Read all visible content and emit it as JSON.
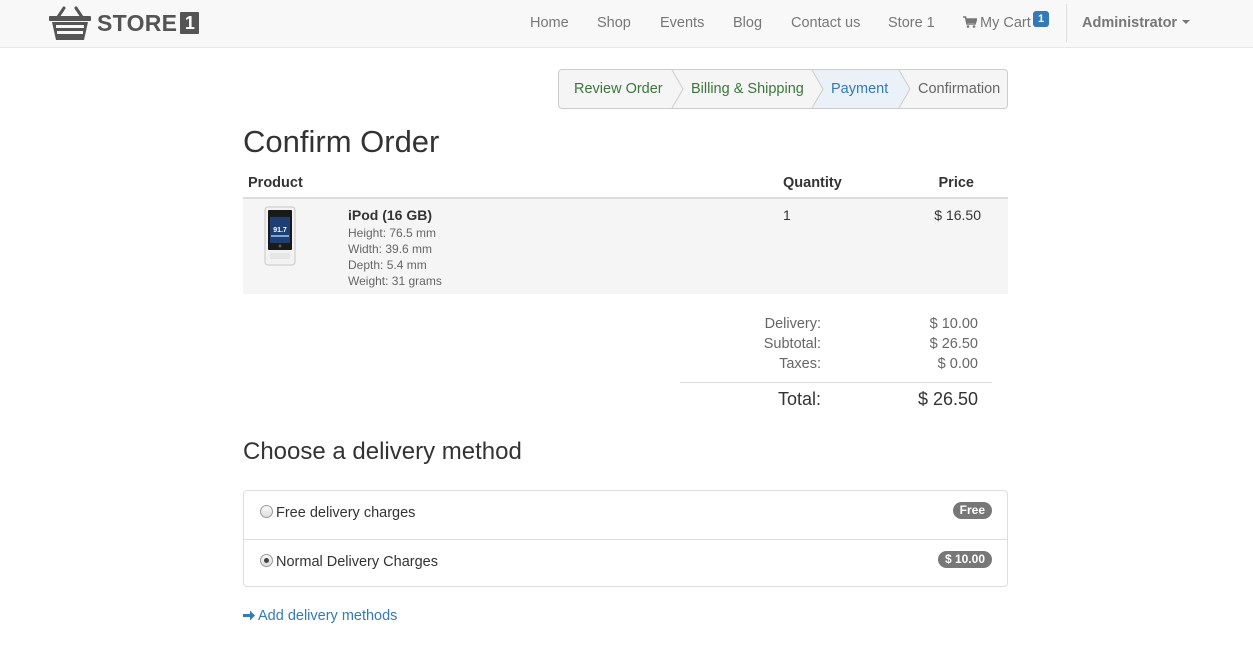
{
  "brand": {
    "name": "STORE",
    "number": "1"
  },
  "nav": {
    "items": [
      "Home",
      "Shop",
      "Events",
      "Blog",
      "Contact us",
      "Store 1"
    ],
    "cart_label": "My Cart",
    "cart_count": "1",
    "user": "Administrator"
  },
  "wizard": {
    "steps": [
      "Review Order",
      "Billing & Shipping",
      "Payment",
      "Confirmation"
    ],
    "active": "Payment"
  },
  "page_title": "Confirm Order",
  "table": {
    "headers": {
      "product": "Product",
      "quantity": "Quantity",
      "price": "Price"
    },
    "rows": [
      {
        "name": "iPod (16 GB)",
        "attrs": [
          "Height: 76.5 mm",
          "Width: 39.6 mm",
          "Depth: 5.4 mm",
          "Weight: 31 grams"
        ],
        "image_screen_text": "91.7",
        "quantity": "1",
        "price": "$ 16.50"
      }
    ]
  },
  "totals": {
    "delivery_label": "Delivery:",
    "delivery": "$ 10.00",
    "subtotal_label": "Subtotal:",
    "subtotal": "$ 26.50",
    "taxes_label": "Taxes:",
    "taxes": "$ 0.00",
    "total_label": "Total:",
    "total": "$ 26.50"
  },
  "delivery": {
    "title": "Choose a delivery method",
    "methods": [
      {
        "label": "Free delivery charges",
        "badge": "Free",
        "selected": false
      },
      {
        "label": "Normal Delivery Charges",
        "badge": "$ 10.00",
        "selected": true
      }
    ],
    "add_link": "Add delivery methods"
  },
  "colors": {
    "link": "#337ab7",
    "done_step": "#3c763d",
    "badge": "#777777",
    "navbar_bg": "#f8f8f8"
  }
}
